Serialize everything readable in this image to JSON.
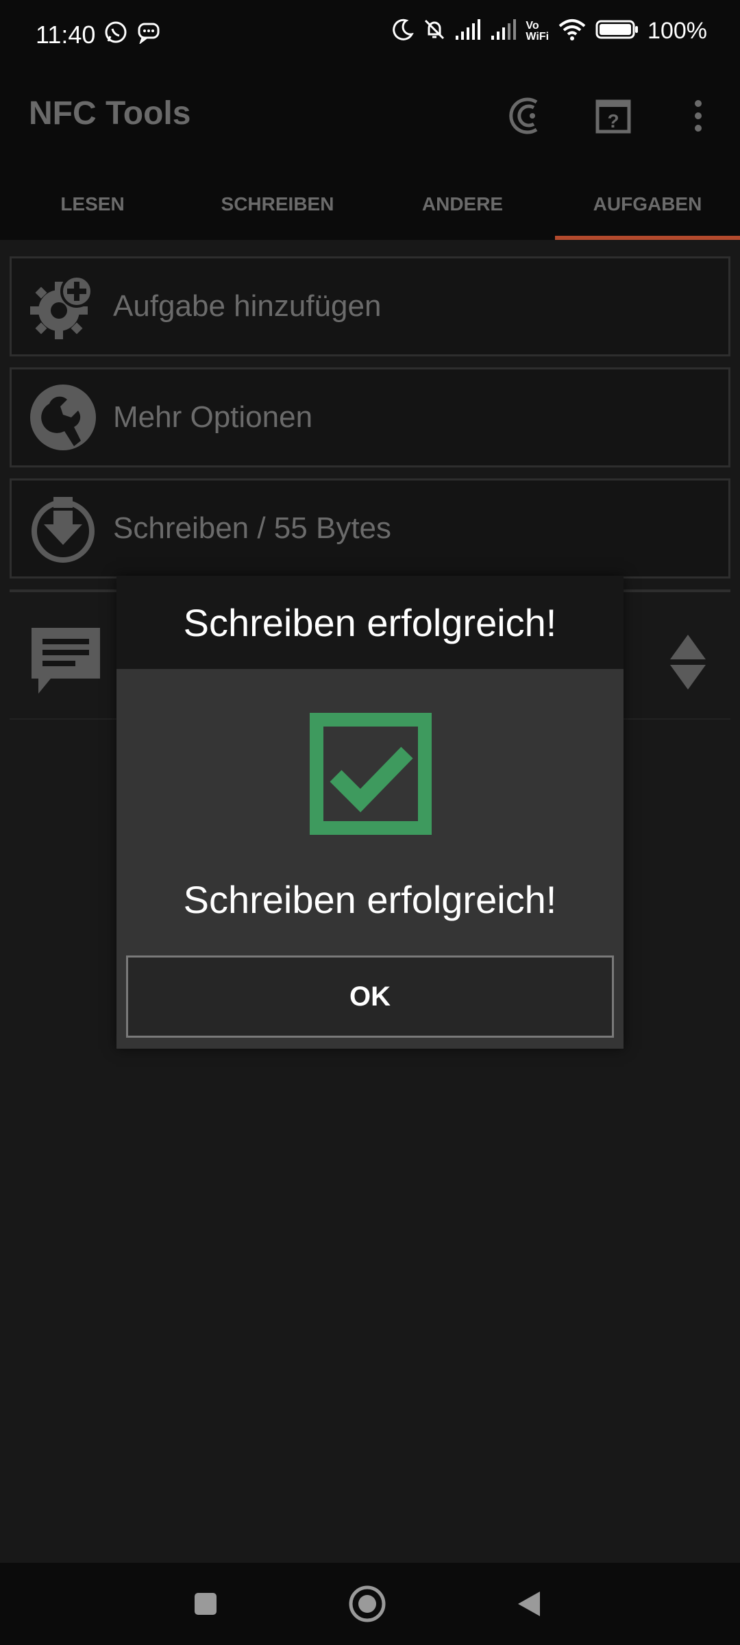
{
  "status_bar": {
    "time": "11:40",
    "battery_text": "100%",
    "icons_left": [
      "whatsapp-icon",
      "message-icon"
    ],
    "icons_right": [
      "moon-icon",
      "bell-off-icon",
      "signal-icon",
      "signal-icon",
      "vowifi-icon",
      "wifi-icon",
      "battery-icon"
    ],
    "vowifi_label_top": "Vo",
    "vowifi_label_bottom": "WiFi"
  },
  "app_bar": {
    "title": "NFC Tools",
    "actions": [
      "nfc-scan-icon",
      "help-icon",
      "more-icon"
    ]
  },
  "tabs": [
    {
      "label": "LESEN",
      "active": false
    },
    {
      "label": "SCHREIBEN",
      "active": false
    },
    {
      "label": "ANDERE",
      "active": false
    },
    {
      "label": "AUFGABEN",
      "active": true
    }
  ],
  "list": {
    "items": [
      {
        "label": "Aufgabe hinzufügen",
        "icon": "gear-add-icon"
      },
      {
        "label": "Mehr Optionen",
        "icon": "wrench-icon"
      },
      {
        "label": "Schreiben / 55 Bytes",
        "icon": "download-icon"
      }
    ]
  },
  "dialog": {
    "title": "Schreiben erfolgreich!",
    "message": "Schreiben erfolgreich!",
    "ok_label": "OK",
    "check_color": "#3e9a5e"
  },
  "colors": {
    "accent": "#b34a2d",
    "background": "#181818"
  }
}
